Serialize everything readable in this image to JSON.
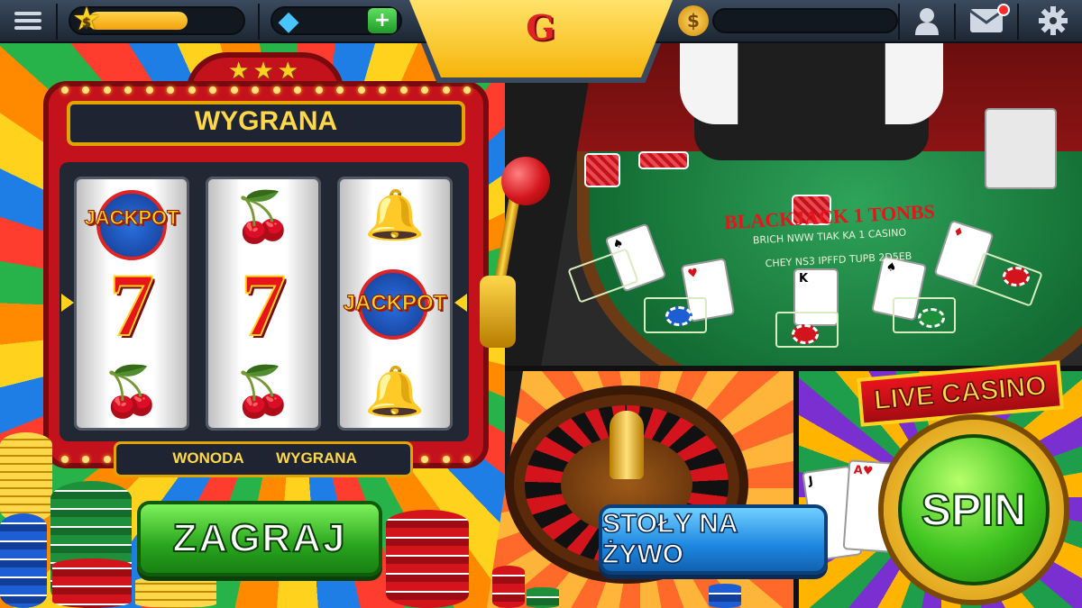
{
  "topbar": {
    "menu_icon": "hamburger-icon",
    "coin_symbol": "$",
    "coin_fill_fraction": 0.66,
    "gem_icon": "diamond-icon",
    "gem_plus": "+",
    "logo": "G",
    "coin2_symbol": "$",
    "user_icon": "user-icon",
    "mail_icon": "mail-icon",
    "settings_icon": "gear-icon"
  },
  "slot": {
    "title": "WYGRANA",
    "reels": [
      [
        "JACKPOT",
        "7",
        "cherry"
      ],
      [
        "cherry",
        "7",
        "cherry"
      ],
      [
        "bell",
        "JACKPOT",
        "bell"
      ]
    ],
    "info_left": "WONODA",
    "info_right": "WYGRANA",
    "play_label": "ZAGRAJ"
  },
  "blackjack": {
    "title": "BLACKJACK 1 TONBS",
    "subtitle_1": "BRICH NWW TIAK KA 1 CASINO",
    "subtitle_2": "CHEY NS3 IPFFD TUPB 2D5EB"
  },
  "roulette": {
    "button_label": "STOŁY NA ŻYWO"
  },
  "live": {
    "banner": "LIVE CASINO",
    "spin_label": "SPIN"
  },
  "colors": {
    "accent_gold": "#ffd21e",
    "play_green": "#2aa41e",
    "live_blue": "#1e86e0",
    "brand_red": "#e02424"
  }
}
